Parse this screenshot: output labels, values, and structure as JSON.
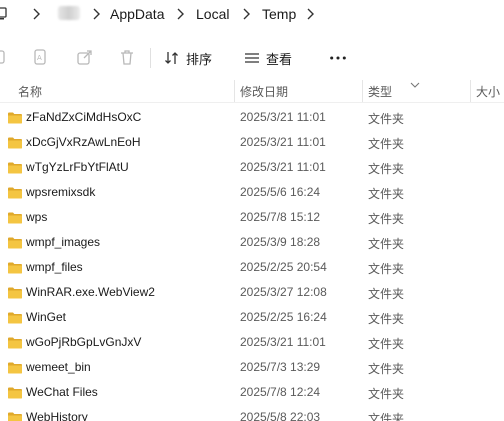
{
  "address": {
    "crumbs": [
      "AppData",
      "Local",
      "Temp"
    ]
  },
  "toolbar": {
    "sort_label": "排序",
    "view_label": "查看",
    "more_label": "···"
  },
  "columns": {
    "name": "名称",
    "modified": "修改日期",
    "type": "类型",
    "size": "大小"
  },
  "files": [
    {
      "name": "zFaNdZxCiMdHsOxC",
      "modified": "2025/3/21 11:01",
      "type": "文件夹"
    },
    {
      "name": "xDcGjVxRzAwLnEoH",
      "modified": "2025/3/21 11:01",
      "type": "文件夹"
    },
    {
      "name": "wTgYzLrFbYtFlAtU",
      "modified": "2025/3/21 11:01",
      "type": "文件夹"
    },
    {
      "name": "wpsremixsdk",
      "modified": "2025/5/6 16:24",
      "type": "文件夹"
    },
    {
      "name": "wps",
      "modified": "2025/7/8 15:12",
      "type": "文件夹"
    },
    {
      "name": "wmpf_images",
      "modified": "2025/3/9 18:28",
      "type": "文件夹"
    },
    {
      "name": "wmpf_files",
      "modified": "2025/2/25 20:54",
      "type": "文件夹"
    },
    {
      "name": "WinRAR.exe.WebView2",
      "modified": "2025/3/27 12:08",
      "type": "文件夹"
    },
    {
      "name": "WinGet",
      "modified": "2025/2/25 16:24",
      "type": "文件夹"
    },
    {
      "name": "wGoPjRbGpLvGnJxV",
      "modified": "2025/3/21 11:01",
      "type": "文件夹"
    },
    {
      "name": "wemeet_bin",
      "modified": "2025/7/3 13:29",
      "type": "文件夹"
    },
    {
      "name": "WeChat Files",
      "modified": "2025/7/8 12:24",
      "type": "文件夹"
    },
    {
      "name": "WebHistory",
      "modified": "2025/5/8 22:03",
      "type": "文件夹"
    }
  ],
  "colors": {
    "folder": "#F4C542",
    "folder_dark": "#E0A92B",
    "text": "#1a1a1a",
    "muted": "#5a5a5a",
    "icon_disabled": "#b8b8b8"
  },
  "icons": [
    "pc-icon",
    "chevron-right-icon",
    "cut-icon",
    "rename-icon",
    "share-icon",
    "delete-icon",
    "sort-icon",
    "view-icon",
    "more-icon",
    "sort-caret-icon",
    "folder-icon"
  ]
}
